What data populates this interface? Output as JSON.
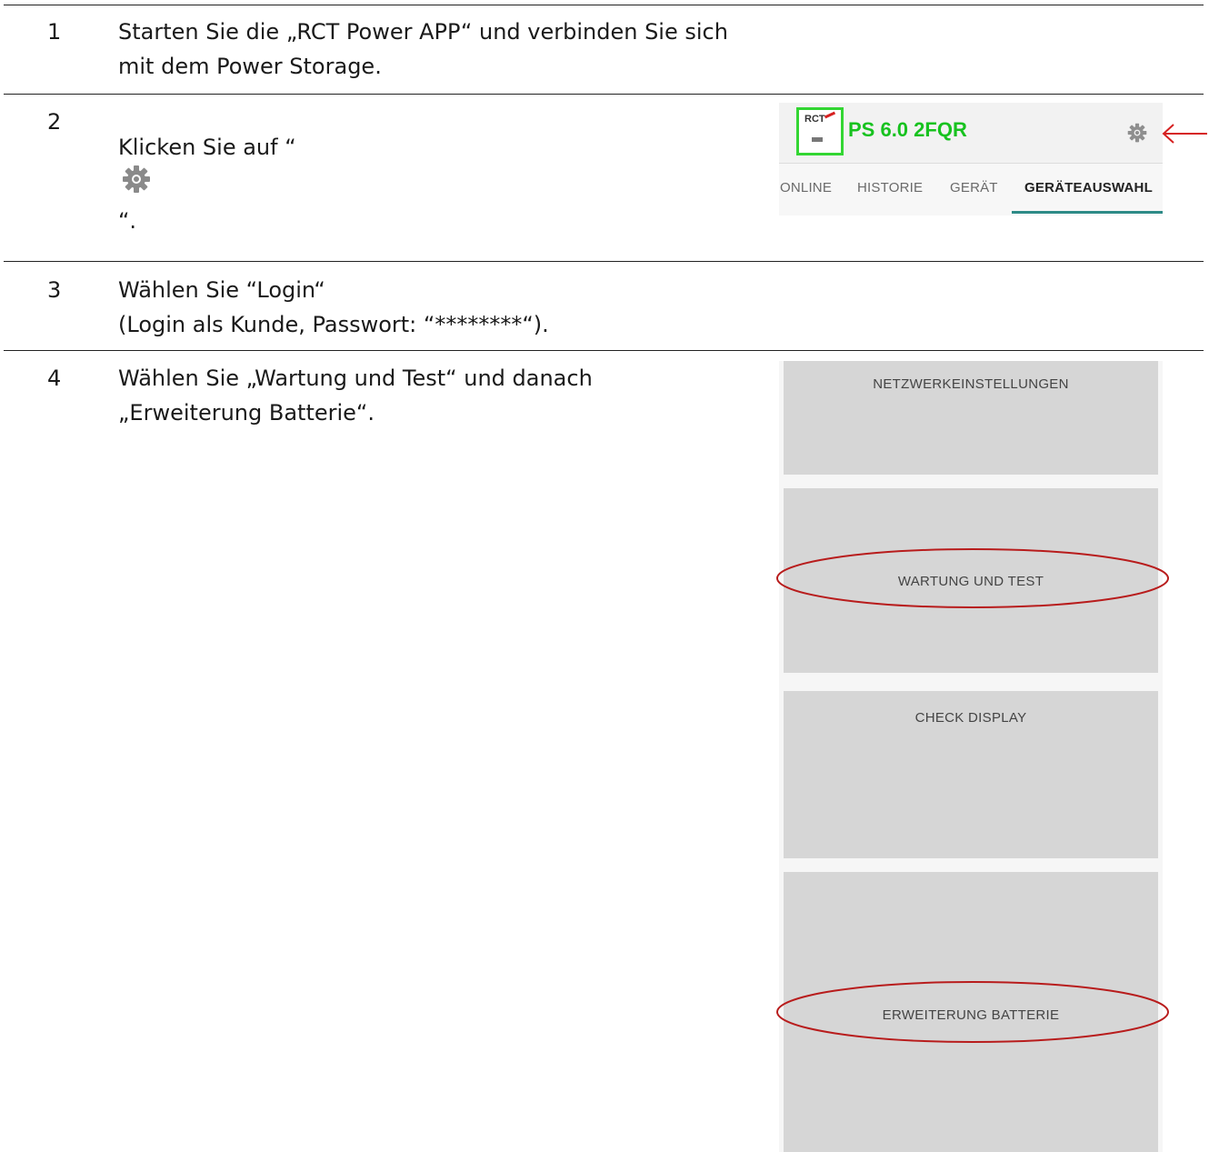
{
  "steps": [
    {
      "number": "1",
      "lines": [
        "Starten Sie die „RCT Power APP“ und verbinden Sie sich",
        "mit dem Power Storage."
      ]
    },
    {
      "number": "2",
      "text_before": "Klicken Sie auf “",
      "text_after": "“."
    },
    {
      "number": "3",
      "lines": [
        "Wählen Sie “Login“",
        "(Login als Kunde, Passwort: “********“)."
      ]
    },
    {
      "number": "4",
      "lines": [
        "Wählen Sie „Wartung und Test“ und danach",
        "„Erweiterung Batterie“."
      ]
    }
  ],
  "app_header": {
    "logo_text": "RCT",
    "device_name": "PS 6.0 2FQR",
    "tabs": [
      "ONLINE",
      "HISTORIE",
      "GERÄT",
      "GERÄTEAUSWAHL"
    ],
    "active_tab": "GERÄTEAUSWAHL",
    "title_color": "#17c21f",
    "highlight_color": "#33d633",
    "arrow_color": "#d62020"
  },
  "settings_menu": {
    "items": [
      "NETZWERKEINSTELLUNGEN",
      "WARTUNG UND TEST",
      "CHECK DISPLAY",
      "ERWEITERUNG BATTERIE"
    ],
    "circled_items": [
      "WARTUNG UND TEST",
      "ERWEITERUNG BATTERIE"
    ],
    "circle_color": "#b81c1c"
  },
  "icons": [
    "gear-icon",
    "left-arrow-icon",
    "rct-logo"
  ]
}
